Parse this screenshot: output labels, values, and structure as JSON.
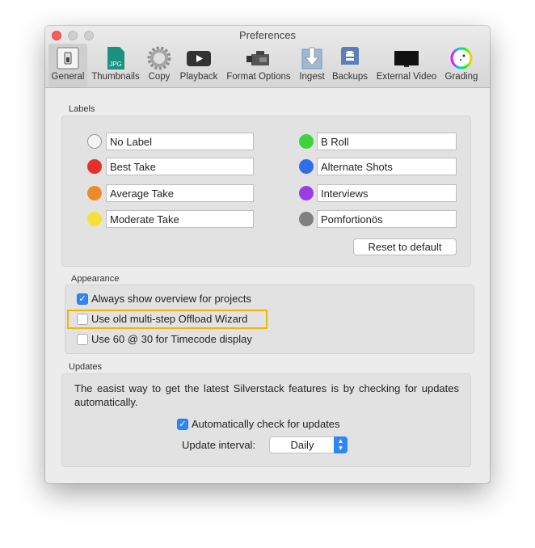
{
  "window": {
    "title": "Preferences"
  },
  "toolbar": [
    {
      "label": "General",
      "icon": "switch-icon"
    },
    {
      "label": "Thumbnails",
      "icon": "jpg-file-icon"
    },
    {
      "label": "Copy",
      "icon": "gear-icon"
    },
    {
      "label": "Playback",
      "icon": "play-icon"
    },
    {
      "label": "Format Options",
      "icon": "camera-icon"
    },
    {
      "label": "Ingest",
      "icon": "download-arrow-icon"
    },
    {
      "label": "Backups",
      "icon": "drive-icon"
    },
    {
      "label": "External Video",
      "icon": "monitor-icon"
    },
    {
      "label": "Grading",
      "icon": "color-wheel-icon"
    }
  ],
  "labels": {
    "heading": "Labels",
    "reset": "Reset to default",
    "items": [
      {
        "name": "No Label",
        "color": "none"
      },
      {
        "name": "Best Take",
        "color": "#e8302b"
      },
      {
        "name": "Average Take",
        "color": "#ee8a2a"
      },
      {
        "name": "Moderate Take",
        "color": "#f2e33a"
      },
      {
        "name": "B Roll",
        "color": "#3fd23c"
      },
      {
        "name": "Alternate Shots",
        "color": "#2f6ee8"
      },
      {
        "name": "Interviews",
        "color": "#9b3ee0"
      },
      {
        "name": "Pomfortionös",
        "color": "#808080"
      }
    ]
  },
  "appearance": {
    "heading": "Appearance",
    "options": [
      {
        "label": "Always show overview for projects",
        "checked": true
      },
      {
        "label": "Use old multi-step Offload Wizard",
        "checked": false,
        "highlight": "#f5b400"
      },
      {
        "label": "Use 60 @ 30 for Timecode display",
        "checked": false
      }
    ]
  },
  "updates": {
    "heading": "Updates",
    "description": "The easist way to get the latest Silverstack features is by checking for updates automatically.",
    "auto_check": {
      "label": "Automatically check for updates",
      "checked": true
    },
    "interval_label": "Update interval:",
    "interval_value": "Daily"
  }
}
